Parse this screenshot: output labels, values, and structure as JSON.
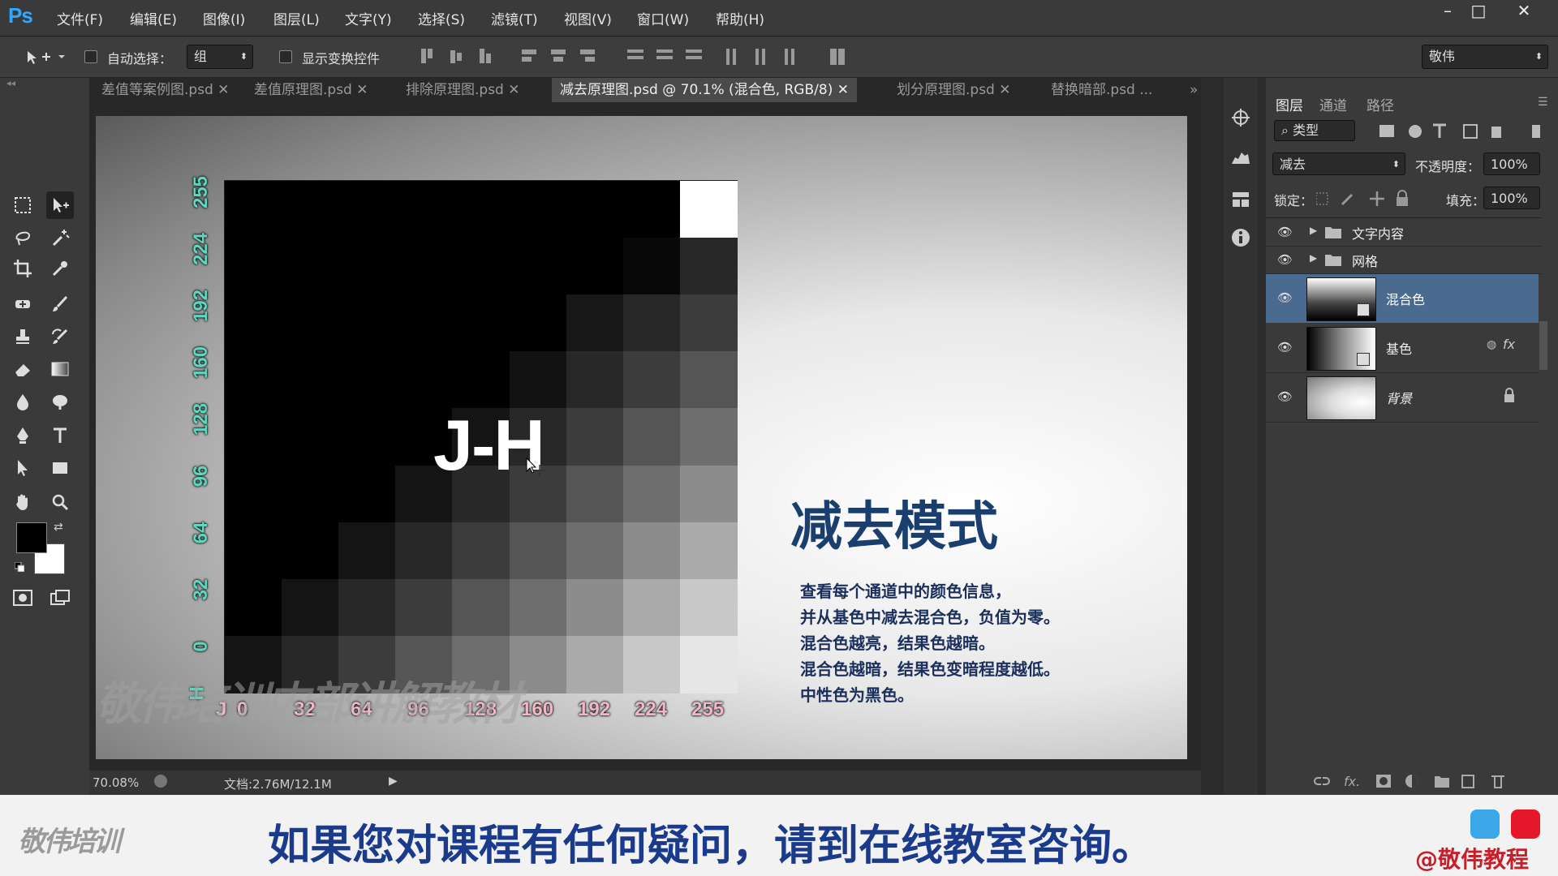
{
  "app": {
    "logo": "Ps"
  },
  "menu": [
    "文件(F)",
    "编辑(E)",
    "图像(I)",
    "图层(L)",
    "文字(Y)",
    "选择(S)",
    "滤镜(T)",
    "视图(V)",
    "窗口(W)",
    "帮助(H)"
  ],
  "window_controls": {
    "minimize": "–",
    "restore": "□",
    "close": "✕"
  },
  "options": {
    "auto_select_label": "自动选择：",
    "auto_select_value": "组",
    "show_transform_label": "显示变换控件",
    "workspace": "敬伟"
  },
  "tabs": [
    "差值等案例图.psd",
    "差值原理图.psd",
    "排除原理图.psd",
    "减去原理图.psd @ 70.1% (混合色, RGB/8)",
    "划分原理图.psd",
    "替换暗部.psd ..."
  ],
  "tab_overflow": "»",
  "canvas": {
    "y_ticks": [
      "255",
      "224",
      "192",
      "160",
      "128",
      "96",
      "64",
      "32",
      "0"
    ],
    "y_axis_letter": "H",
    "x_axis_letter": "J",
    "x_ticks": [
      "0",
      "32",
      "64",
      "96",
      "128",
      "160",
      "192",
      "224",
      "255"
    ],
    "grid_text": "J-H",
    "grid_values": [
      [
        0,
        0,
        0,
        0,
        0,
        0,
        0,
        0,
        255
      ],
      [
        0,
        0,
        0,
        0,
        0,
        0,
        0,
        8,
        40
      ],
      [
        0,
        0,
        0,
        0,
        0,
        0,
        24,
        40,
        60
      ],
      [
        0,
        0,
        0,
        0,
        0,
        18,
        40,
        60,
        85
      ],
      [
        0,
        0,
        0,
        0,
        20,
        40,
        60,
        85,
        110
      ],
      [
        0,
        0,
        0,
        20,
        40,
        60,
        85,
        110,
        140
      ],
      [
        0,
        0,
        20,
        40,
        60,
        85,
        110,
        140,
        170
      ],
      [
        0,
        20,
        40,
        60,
        85,
        110,
        140,
        170,
        200
      ],
      [
        20,
        40,
        60,
        85,
        110,
        140,
        170,
        200,
        230
      ]
    ],
    "heading": "减去模式",
    "body_lines": [
      "查看每个通道中的颜色信息，",
      "并从基色中减去混合色，负值为零。",
      "混合色越亮，结果色越暗。",
      "混合色越暗，结果色变暗程度越低。",
      "中性色为黑色。"
    ],
    "watermark": "敬伟培训内部讲解教材"
  },
  "status": {
    "zoom": "70.08%",
    "doc_info": "文档:2.76M/12.1M"
  },
  "layers_panel": {
    "tabs": [
      "图层",
      "通道",
      "路径"
    ],
    "filter_label": "类型",
    "blend_mode": "减去",
    "opacity_label": "不透明度：",
    "opacity_value": "100%",
    "lock_label": "锁定：",
    "fill_label": "填充：",
    "fill_value": "100%",
    "groups": [
      "文字内容",
      "网格"
    ],
    "layers": [
      {
        "name": "混合色",
        "selected": true
      },
      {
        "name": "基色",
        "selected": false
      },
      {
        "name": "背景",
        "selected": false
      }
    ],
    "fx_label": "fx"
  },
  "footer": {
    "logo": "敬伟培训",
    "message": "如果您对课程有任何疑问，请到在线教室咨询。",
    "handle": "@敬伟教程"
  },
  "colors": {
    "selected_layer": "#4b6a8f",
    "heading": "#1a3f6e",
    "body_text": "#1b2f5c",
    "axis_y": "#5fd6c0",
    "axis_x": "#f2b6c6",
    "ps_blue": "#31a8ff"
  }
}
